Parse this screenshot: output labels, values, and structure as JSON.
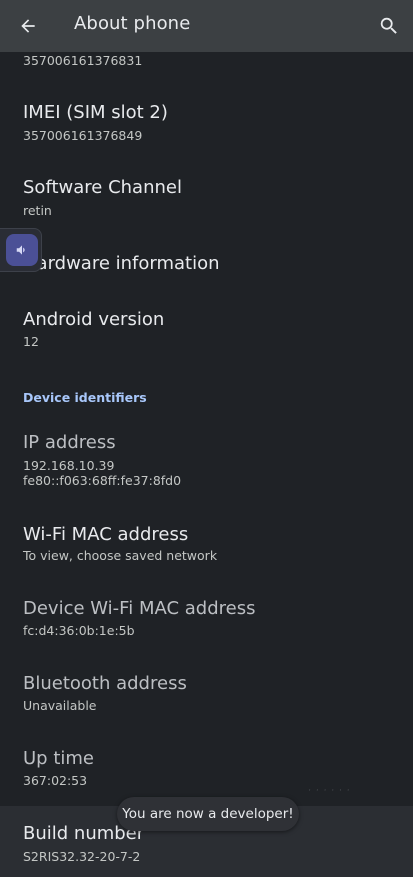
{
  "app_bar": {
    "title": "About phone",
    "back_icon": "arrow-back-icon",
    "search_icon": "search-icon"
  },
  "rows": {
    "imei1_summary": "357006161376831",
    "imei2": {
      "title": "IMEI (SIM slot 2)",
      "summary": "357006161376849"
    },
    "software_channel": {
      "title": "Software Channel",
      "summary": "retin"
    },
    "hardware": {
      "title": "Hardware information"
    },
    "android_version": {
      "title": "Android version",
      "summary": "12"
    }
  },
  "section": {
    "device_identifiers": "Device identifiers"
  },
  "identifiers": {
    "ip": {
      "title": "IP address",
      "summary_line1": "192.168.10.39",
      "summary_line2": "fe80::f063:68ff:fe37:8fd0"
    },
    "wifi_mac": {
      "title": "Wi-Fi MAC address",
      "summary": "To view, choose saved network"
    },
    "device_wifi_mac": {
      "title": "Device Wi-Fi MAC address",
      "summary": "fc:d4:36:0b:1e:5b"
    },
    "bluetooth": {
      "title": "Bluetooth address",
      "summary": "Unavailable"
    },
    "uptime": {
      "title": "Up time",
      "summary": "367:02:53"
    },
    "build": {
      "title": "Build number",
      "summary": "S2RIS32.32-20-7-2"
    }
  },
  "toast": {
    "text": "You are now a developer!"
  },
  "volume": {
    "icon": "volume-icon"
  },
  "colors": {
    "app_bar": "#3c4043",
    "background": "#1f2226",
    "accent": "#a8c7fa",
    "volume_chip": "#4b5096"
  }
}
